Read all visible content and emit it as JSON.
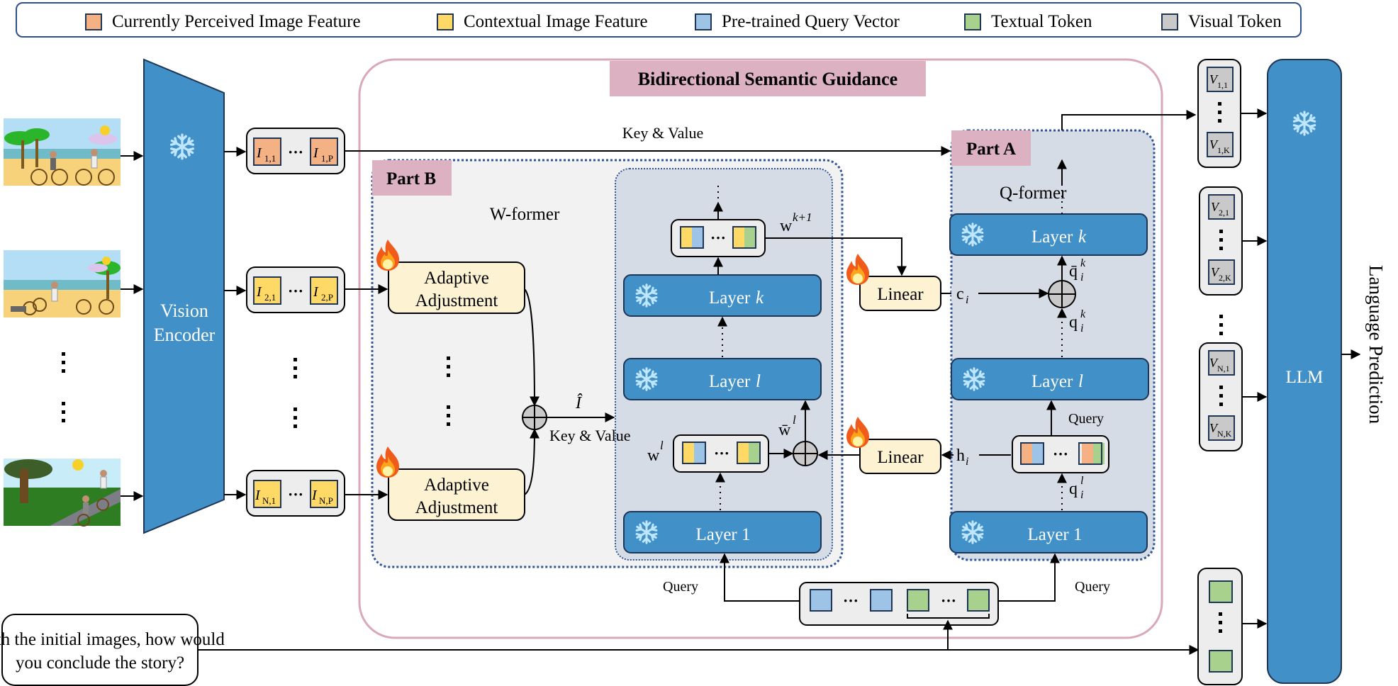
{
  "legend": [
    {
      "label": "Currently Perceived Image Feature",
      "color": "#f4b183"
    },
    {
      "label": "Contextual Image Feature",
      "color": "#ffd966"
    },
    {
      "label": "Pre-trained Query Vector",
      "color": "#9dc3e6"
    },
    {
      "label": "Textual Token",
      "color": "#a9d18e"
    },
    {
      "label": "Visual Token",
      "color": "#c9c9c9"
    }
  ],
  "colors": {
    "encoder_blue": "#4190c8",
    "bsg_border": "#d9a9b9",
    "title_tag": "#dcb1c1",
    "panel_gray": "#f2f2f2",
    "inner_panel": "#d6dce6",
    "trainable_box": "#fdf3d3",
    "dotted_border": "#2f5597"
  },
  "vision_encoder": {
    "label_line1": "Vision",
    "label_line2": "Encoder",
    "state": "frozen"
  },
  "llm": {
    "label": "LLM",
    "state": "frozen"
  },
  "output_label": "Language Prediction",
  "bsg": {
    "title": "Bidirectional Semantic Guidance"
  },
  "part_a": {
    "tag": "Part A",
    "module": "Q-former"
  },
  "part_b": {
    "tag": "Part B",
    "module": "W-former"
  },
  "feature_groups": [
    {
      "first": "I",
      "first_sub": "1,1",
      "last": "I",
      "last_sub": "1,P",
      "kind": "current"
    },
    {
      "first": "I",
      "first_sub": "2,1",
      "last": "I",
      "last_sub": "2,P",
      "kind": "context"
    },
    {
      "first": "I",
      "first_sub": "N,1",
      "last": "I",
      "last_sub": "N,P",
      "kind": "context"
    }
  ],
  "visual_token_groups": [
    {
      "first_sub": "1,1",
      "last_sub": "1,K"
    },
    {
      "first_sub": "2,1",
      "last_sub": "2,K"
    },
    {
      "first_sub": "N,1",
      "last_sub": "N,K"
    }
  ],
  "adaptive_adjustment": {
    "line1": "Adaptive",
    "line2": "Adjustment",
    "state": "trainable"
  },
  "linear": {
    "label": "Linear",
    "state": "trainable"
  },
  "layers": {
    "k": "Layer",
    "k_var": "k",
    "l": "Layer",
    "l_var": "l",
    "one": "Layer 1"
  },
  "labels": {
    "key_value": "Key & Value",
    "query": "Query",
    "i_hat": "Î",
    "w_k1": "w",
    "w_k1_sup": "k+1",
    "w_l": "w",
    "w_l_sup": "l",
    "w_bar_l": "w̄",
    "c_i": "c",
    "h_i": "h",
    "sub_i": "i",
    "q_bar_k": "q̄",
    "q_k": "q",
    "q_l": "q",
    "sup_k": "k",
    "sup_l": "l",
    "ellipsis": "···"
  },
  "prompt": {
    "line1": "With the initial images, how would",
    "line2": "you conclude the story?"
  },
  "scenes": [
    {
      "name": "beach scene with two cyclists"
    },
    {
      "name": "beach scene with fallen cyclist"
    },
    {
      "name": "park scene with two cyclists on path"
    }
  ]
}
